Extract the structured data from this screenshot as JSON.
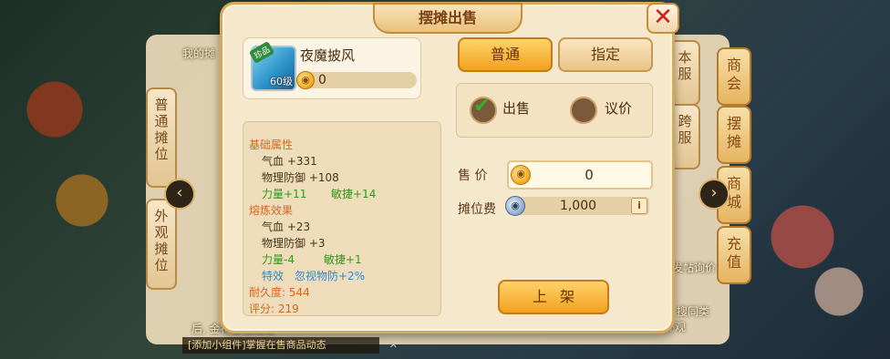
{
  "dialog": {
    "title": "摆摊出售",
    "close_symbol": "✕"
  },
  "item": {
    "name": "夜魔披风",
    "tag": "珍品",
    "level": "60级",
    "price": "0"
  },
  "attributes": {
    "base_title": "基础属性",
    "base": [
      {
        "text": "气血 +331"
      },
      {
        "text": "物理防御 +108"
      }
    ],
    "base_bonus": [
      "力量+11",
      "敏捷+14"
    ],
    "refine_title": "熔炼效果",
    "refine": [
      {
        "text": "气血 +23"
      },
      {
        "text": "物理防御 +3"
      }
    ],
    "refine_bonus": [
      "力量-4",
      "敏捷+1"
    ],
    "special": [
      "特效",
      "忽视物防+2%"
    ],
    "durability": "耐久度: 544",
    "score": "评分: 219"
  },
  "tabs": {
    "normal": "普通",
    "designated": "指定"
  },
  "mode": {
    "sell": "出售",
    "negotiate": "议价",
    "selected": "出售"
  },
  "form": {
    "price_label": "售  价",
    "price_value": "0",
    "fee_label": "摊位费",
    "fee_value": "1,000",
    "info": "i",
    "list_button": "上架"
  },
  "background": {
    "left_tabs": [
      "普通摊位",
      "外观摊位"
    ],
    "right_tabs": [
      "本服",
      "跨服"
    ],
    "far_right": [
      "商会",
      "摆摊",
      "商城",
      "充值"
    ],
    "my_label": "我的摊",
    "post_ask": "发帖询价",
    "search_same": "搜同类",
    "bottom_text": "[添加小组件]掌握在售商品动态",
    "appearance": "外观",
    "charge": "充值",
    "tip": "后, 金符会被返还",
    "arrow_left": "‹",
    "arrow_right": "›"
  }
}
